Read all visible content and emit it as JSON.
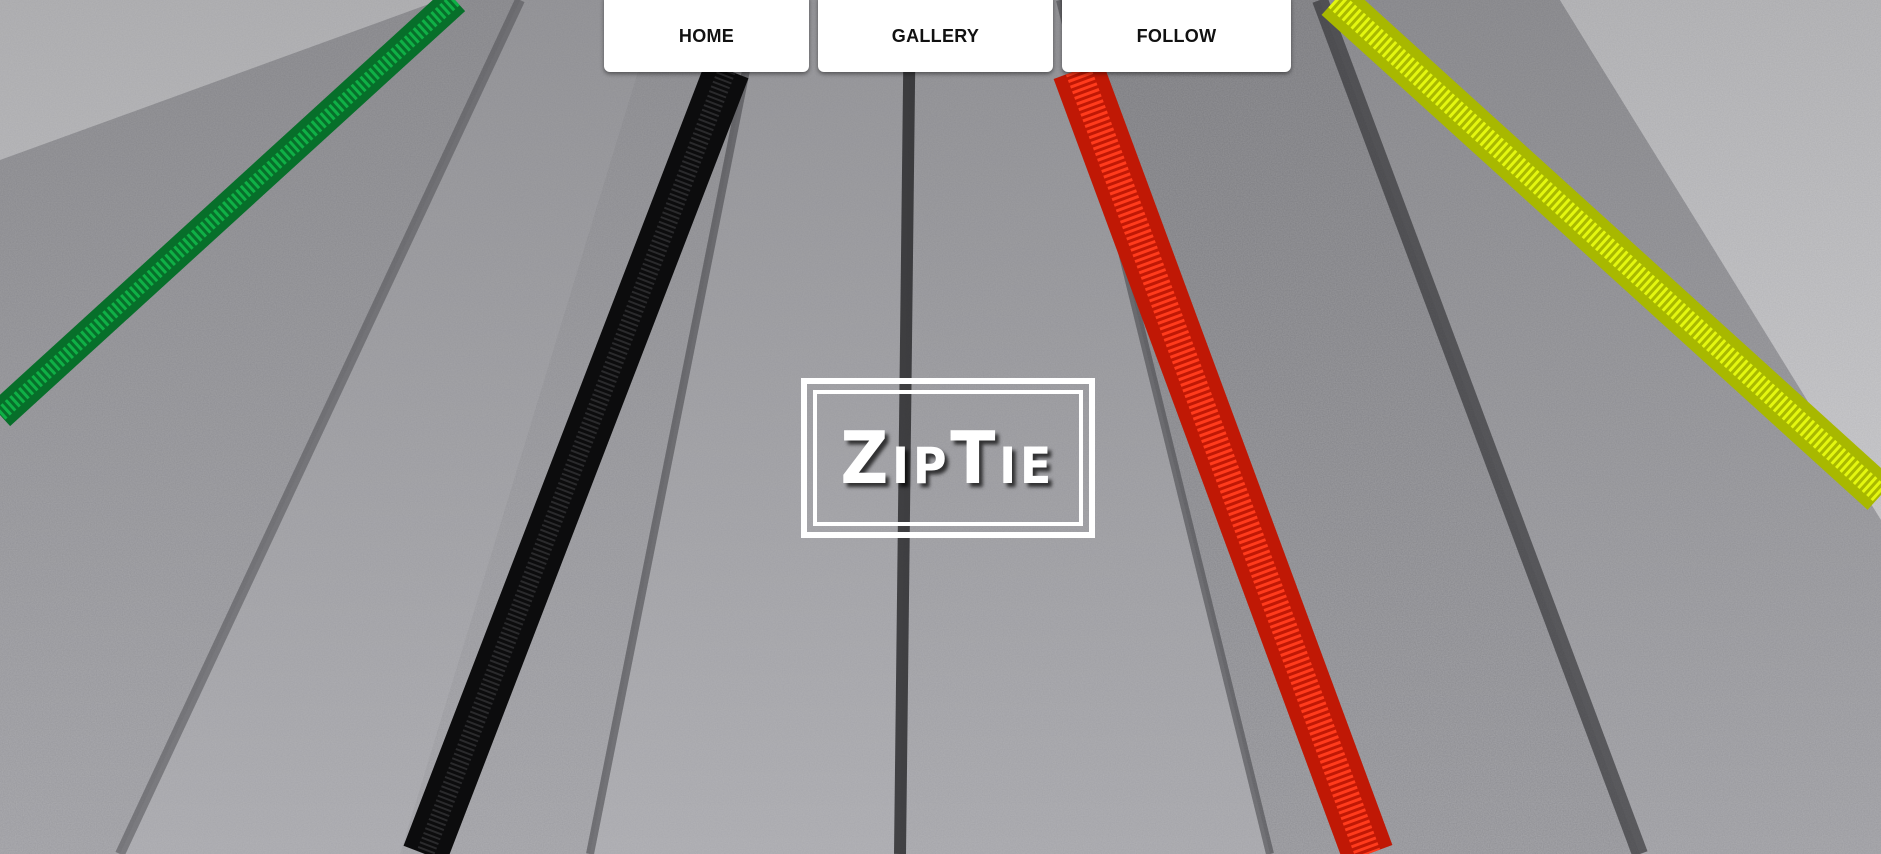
{
  "nav": {
    "items": [
      {
        "label": "HOME"
      },
      {
        "label": "GALLERY"
      },
      {
        "label": "FOLLOW"
      }
    ]
  },
  "logo": {
    "text": "ZipTie"
  },
  "colors": {
    "nav_background": "#ffffff",
    "nav_text": "#111111",
    "logo": "#ffffff",
    "felt": "#a0a0a4",
    "zip_green": "#0a9a3a",
    "zip_black": "#151515",
    "zip_red": "#ff2a10",
    "zip_yellow": "#d8f000"
  },
  "background": {
    "icon": "felt-zipper-photo"
  }
}
